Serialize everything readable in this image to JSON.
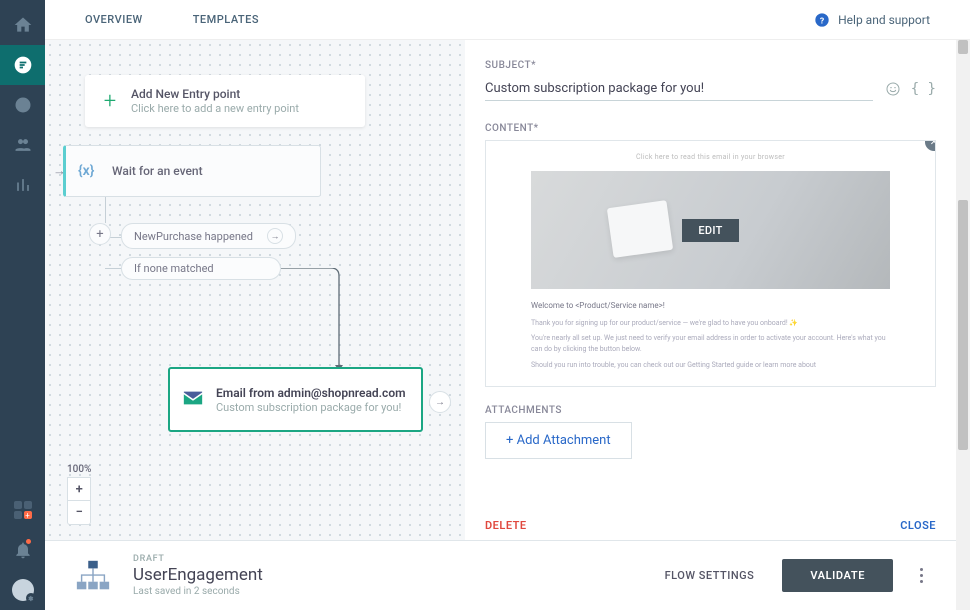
{
  "nav": {
    "tabs": [
      "OVERVIEW",
      "TEMPLATES"
    ],
    "help": "Help and support"
  },
  "canvas": {
    "entry": {
      "title": "Add New Entry point",
      "subtitle": "Click here to add a new entry point"
    },
    "wait": {
      "title": "Wait for an event"
    },
    "branch1": "NewPurchase happened",
    "branch2": "If none matched",
    "email": {
      "title": "Email from admin@shopnread.com",
      "subtitle": "Custom subscription package for you!"
    },
    "zoom": "100%"
  },
  "panel": {
    "subject_label": "SUBJECT*",
    "subject_value": "Custom subscription package for you!",
    "content_label": "CONTENT*",
    "edit_btn": "EDIT",
    "preview_topline": "Click here to read this email in your browser",
    "preview_welcome": "Welcome to <Product/Service name>!",
    "preview_para1": "Thank you for signing up for our product/service — we're glad to have you onboard! ✨",
    "preview_para2": "You're nearly all set up. We just need to verify your email address in order to activate your account. Here's what you can do by clicking the button below.",
    "preview_para3": "Should you run into trouble, you can check out our Getting Started guide or learn more about",
    "attachments_label": "ATTACHMENTS",
    "add_attachment": "+ Add Attachment",
    "delete": "DELETE",
    "close": "CLOSE"
  },
  "bottom": {
    "status": "DRAFT",
    "name": "UserEngagement",
    "saved": "Last saved in 2 seconds",
    "flow_settings": "FLOW SETTINGS",
    "validate": "VALIDATE"
  }
}
